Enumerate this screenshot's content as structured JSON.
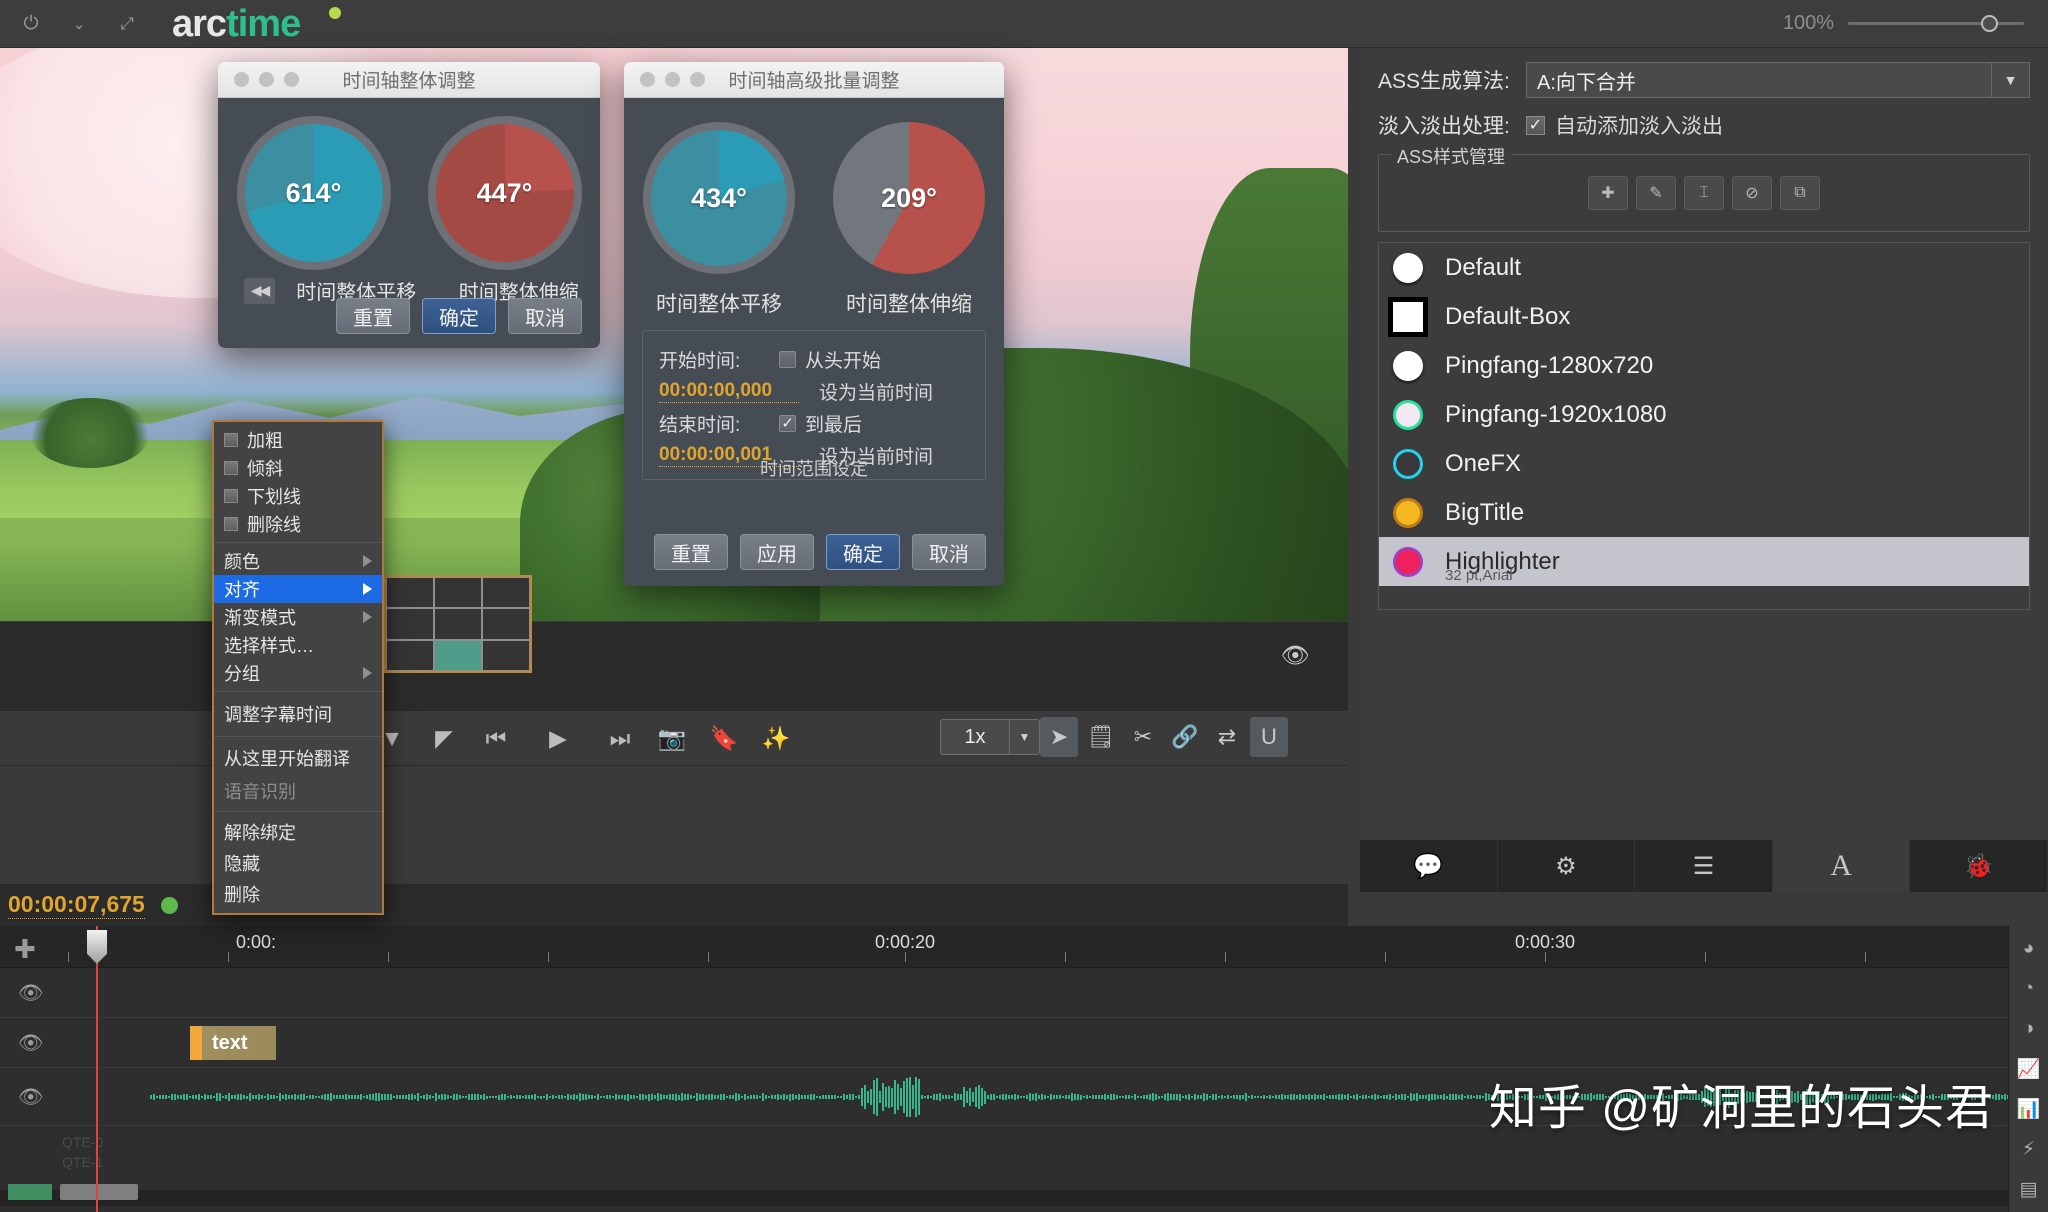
{
  "app": {
    "logo_white": "arc",
    "logo_green": "time",
    "zoom_label": "100%"
  },
  "titlebar_icons": [
    "power-icon",
    "chevron-down-icon",
    "expand-icon"
  ],
  "dialog_shift": {
    "title": "时间轴整体调整",
    "dials": [
      {
        "value": "614°",
        "label": "时间整体平移",
        "color": "#2b9cb5",
        "kind": "shift"
      },
      {
        "value": "447°",
        "label": "时间整体伸缩",
        "color": "#b7514b",
        "kind": "scale"
      }
    ],
    "rewind_icon": "rewind-to-start-icon",
    "buttons": [
      {
        "label": "重置",
        "primary": false
      },
      {
        "label": "确定",
        "primary": true
      },
      {
        "label": "取消",
        "primary": false
      }
    ]
  },
  "dialog_batch": {
    "title": "时间轴高级批量调整",
    "dials": [
      {
        "value": "434°",
        "label": "时间整体平移",
        "color": "#2b9cb5",
        "kind": "shift"
      },
      {
        "value": "209°",
        "label": "时间整体伸缩",
        "color": "#b7514b",
        "kind": "scale"
      }
    ],
    "range": {
      "caption": "时间范围设定",
      "start_label": "开始时间:",
      "start_value": "00:00:00,000",
      "start_checkbox_label": "从头开始",
      "start_checked": false,
      "start_hint": "设为当前时间",
      "end_label": "结束时间:",
      "end_value": "00:00:00,001",
      "end_checkbox_label": "到最后",
      "end_checked": true,
      "end_hint": "设为当前时间"
    },
    "buttons": [
      {
        "label": "重置",
        "primary": false
      },
      {
        "label": "应用",
        "primary": false
      },
      {
        "label": "确定",
        "primary": true
      },
      {
        "label": "取消",
        "primary": false
      }
    ]
  },
  "context_menu": {
    "items": [
      {
        "label": "加粗",
        "type": "checkbox",
        "checked": false
      },
      {
        "label": "倾斜",
        "type": "checkbox",
        "checked": false
      },
      {
        "label": "下划线",
        "type": "checkbox",
        "checked": false
      },
      {
        "label": "删除线",
        "type": "checkbox",
        "checked": false
      },
      {
        "type": "separator"
      },
      {
        "label": "颜色",
        "type": "submenu"
      },
      {
        "label": "对齐",
        "type": "submenu",
        "selected": true
      },
      {
        "label": "渐变模式",
        "type": "submenu"
      },
      {
        "label": "选择样式…",
        "type": "item"
      },
      {
        "label": "分组",
        "type": "submenu"
      },
      {
        "type": "separator"
      },
      {
        "label": "调整字幕时间",
        "type": "item"
      },
      {
        "type": "separator"
      },
      {
        "label": "从这里开始翻译",
        "type": "item"
      },
      {
        "label": "语音识别",
        "type": "item",
        "disabled": true
      },
      {
        "type": "separator"
      },
      {
        "label": "解除绑定",
        "type": "item"
      },
      {
        "label": "隐藏",
        "type": "item"
      },
      {
        "label": "删除",
        "type": "item"
      }
    ]
  },
  "right_panel": {
    "algo_label": "ASS生成算法:",
    "algo_value": "A:向下合并",
    "fade_label": "淡入淡出处理:",
    "fade_checkbox_label": "自动添加淡入淡出",
    "fade_checked": true,
    "style_manager_legend": "ASS样式管理",
    "manager_buttons": [
      "add-icon",
      "edit-icon",
      "text-cursor-icon",
      "apply-check-icon",
      "duplicate-icon"
    ],
    "styles": [
      {
        "name": "Default",
        "swatch": "#ffffff",
        "ring": "#ffffff",
        "square": false,
        "active": false,
        "sub": ""
      },
      {
        "name": "Default-Box",
        "swatch": "#ffffff",
        "ring": "#000000",
        "square": true,
        "active": false,
        "sub": ""
      },
      {
        "name": "Pingfang-1280x720",
        "swatch": "#ffffff",
        "ring": "#ffffff",
        "square": false,
        "active": false,
        "sub": ""
      },
      {
        "name": "Pingfang-1920x1080",
        "swatch": "#f4e9f2",
        "ring": "#27e0a1",
        "square": false,
        "active": false,
        "sub": ""
      },
      {
        "name": "OneFX",
        "swatch": "#3a3a3a",
        "ring": "#23d3f0",
        "square": false,
        "active": false,
        "sub": ""
      },
      {
        "name": "BigTitle",
        "swatch": "#f2b721",
        "ring": "#c07c18",
        "square": false,
        "active": false,
        "sub": ""
      },
      {
        "name": "Highlighter",
        "swatch": "#f0215c",
        "ring": "#a03ec0",
        "square": false,
        "active": true,
        "sub": "32 pt,Arial"
      }
    ],
    "tabs": [
      {
        "icon": "speech-bubble-icon",
        "active": false
      },
      {
        "icon": "gear-icon",
        "active": false
      },
      {
        "icon": "list-icon",
        "active": false
      },
      {
        "icon": "font-A-icon",
        "active": true
      },
      {
        "icon": "bug-icon",
        "active": false
      }
    ]
  },
  "transport": {
    "timecode": "00:00:07,675",
    "status_dot_color": "#5db84e",
    "eye_icon": "eye-icon",
    "buttons": [
      "prev-marker-icon",
      "mark-in-icon",
      "step-back-icon",
      "play-icon",
      "step-forward-icon",
      "snapshot-icon",
      "bookmark-icon",
      "magic-wand-icon"
    ],
    "speed_value": "1x",
    "tools": [
      {
        "icon": "pointer-icon",
        "active": true
      },
      {
        "icon": "edit-box-icon",
        "active": false
      },
      {
        "icon": "scissors-icon",
        "active": false
      },
      {
        "icon": "link-icon",
        "active": false
      },
      {
        "icon": "swap-icon",
        "active": false
      },
      {
        "icon": "magnet-icon",
        "active": true
      }
    ]
  },
  "timeline": {
    "ruler_labels": [
      "0:00:",
      "0:00:20",
      "0:00:30"
    ],
    "clip_label": "text",
    "track_eye_icon": "eye-icon",
    "add_track_icon": "plus-icon",
    "side_icons": [
      "pie-chart-1-icon",
      "pie-chart-2-icon",
      "pie-chart-3-icon",
      "area-chart-icon",
      "bar-chart-icon",
      "lightning-icon",
      "table-icon"
    ]
  },
  "watermark": "知乎 @矿洞里的石头君"
}
